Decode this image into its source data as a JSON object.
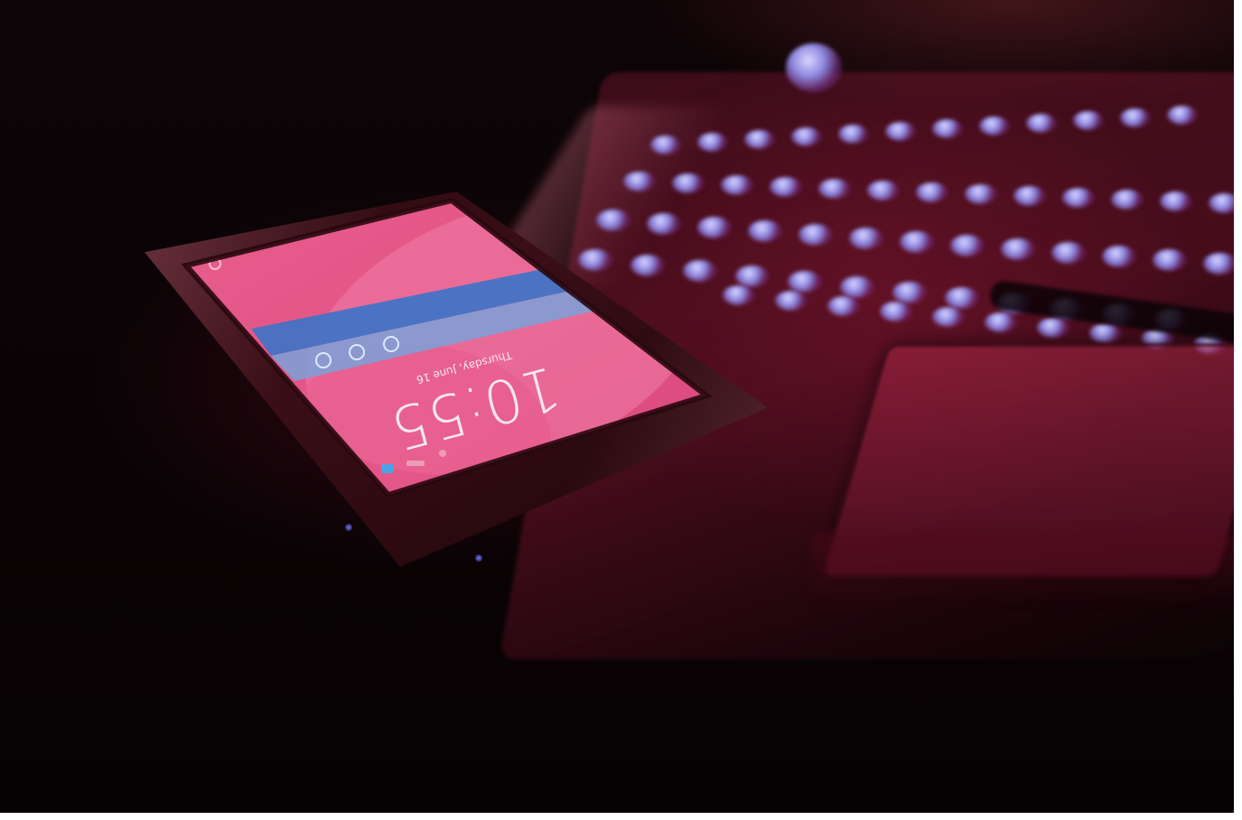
{
  "scene": {
    "description_colors": {
      "screen_pink": "#e0507e",
      "screen_circle": "#ec6a96",
      "notification_blue": "#3b74c8",
      "keyboard_glow": "#b8b4ff",
      "laptop_red": "#8e1c3a",
      "background": "#0a0305"
    }
  },
  "phone": {
    "lockscreen": {
      "time": "10:55",
      "date": "Thursday, June 16"
    },
    "icons": [
      "camera-icon",
      "phone-icon",
      "message-icon",
      "settings-icon"
    ]
  }
}
